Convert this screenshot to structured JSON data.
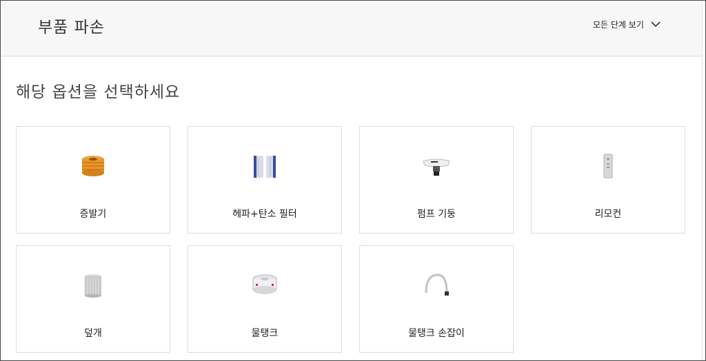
{
  "header": {
    "title": "부품 파손",
    "all_steps_label": "모든 단계 보기"
  },
  "main": {
    "prompt": "해당 옵션을 선택하세요",
    "options": [
      {
        "label": "증발기",
        "image": "evaporator-image"
      },
      {
        "label": "헤파+탄소 필터",
        "image": "hepa-carbon-filter-image"
      },
      {
        "label": "펌프 기둥",
        "image": "pump-column-image"
      },
      {
        "label": "리모컨",
        "image": "remote-control-image"
      },
      {
        "label": "덮개",
        "image": "cover-image"
      },
      {
        "label": "물탱크",
        "image": "water-tank-image"
      },
      {
        "label": "물탱크 손잡이",
        "image": "water-tank-handle-image"
      }
    ]
  },
  "colors": {
    "header_bg": "#f7f7f7",
    "border": "#dddddd",
    "text": "#333333",
    "evaporator_orange": "#e8962a"
  }
}
